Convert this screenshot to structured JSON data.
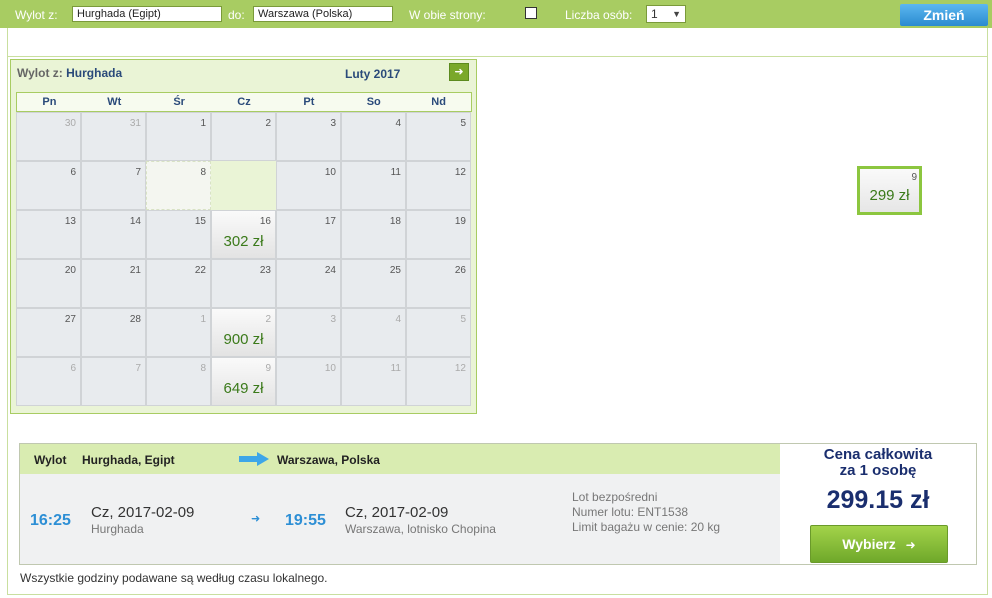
{
  "search": {
    "from_label": "Wylot z:",
    "from_value": "Hurghada (Egipt)",
    "to_label": "do:",
    "to_value": "Warszawa (Polska)",
    "roundtrip_label": "W obie strony:",
    "roundtrip_checked": false,
    "persons_label": "Liczba osób:",
    "persons_value": "1",
    "submit_label": "Zmień"
  },
  "calendar": {
    "heading_prefix": "Wylot z:",
    "heading_city": "Hurghada",
    "month": "Luty 2017",
    "next_icon": "arrow-right-icon",
    "weekdays": [
      "Pn",
      "Wt",
      "Śr",
      "Cz",
      "Pt",
      "So",
      "Nd"
    ],
    "weeks": [
      [
        {
          "d": "30",
          "dim": true
        },
        {
          "d": "31",
          "dim": true
        },
        {
          "d": "1"
        },
        {
          "d": "2"
        },
        {
          "d": "3"
        },
        {
          "d": "4"
        },
        {
          "d": "5"
        }
      ],
      [
        {
          "d": "6"
        },
        {
          "d": "7"
        },
        {
          "d": "8",
          "blank": true
        },
        {
          "d": "9",
          "price": "299 zł",
          "selected": true
        },
        {
          "d": "10"
        },
        {
          "d": "11"
        },
        {
          "d": "12"
        }
      ],
      [
        {
          "d": "13"
        },
        {
          "d": "14"
        },
        {
          "d": "15"
        },
        {
          "d": "16",
          "price": "302 zł"
        },
        {
          "d": "17"
        },
        {
          "d": "18"
        },
        {
          "d": "19"
        }
      ],
      [
        {
          "d": "20"
        },
        {
          "d": "21"
        },
        {
          "d": "22"
        },
        {
          "d": "23"
        },
        {
          "d": "24"
        },
        {
          "d": "25"
        },
        {
          "d": "26"
        }
      ],
      [
        {
          "d": "27"
        },
        {
          "d": "28"
        },
        {
          "d": "1",
          "dim": true
        },
        {
          "d": "2",
          "dim": true,
          "price": "900 zł"
        },
        {
          "d": "3",
          "dim": true
        },
        {
          "d": "4",
          "dim": true
        },
        {
          "d": "5",
          "dim": true
        }
      ],
      [
        {
          "d": "6",
          "dim": true
        },
        {
          "d": "7",
          "dim": true
        },
        {
          "d": "8",
          "dim": true
        },
        {
          "d": "9",
          "dim": true,
          "price": "649 zł"
        },
        {
          "d": "10",
          "dim": true
        },
        {
          "d": "11",
          "dim": true
        },
        {
          "d": "12",
          "dim": true
        }
      ]
    ]
  },
  "flight": {
    "label": "Wylot",
    "origin_header": "Hurghada, Egipt",
    "dest_header": "Warszawa, Polska",
    "dep_time": "16:25",
    "dep_date": "Cz, 2017-02-09",
    "dep_place": "Hurghada",
    "arr_time": "19:55",
    "arr_date": "Cz, 2017-02-09",
    "arr_place": "Warszawa, lotnisko Chopina",
    "info_direct": "Lot bezpośredni",
    "info_number": "Numer lotu: ENT1538",
    "info_baggage": "Limit bagażu w cenie: 20 kg",
    "price_title_1": "Cena całkowita",
    "price_title_2": "za 1 osobę",
    "price_value": "299.15 zł",
    "select_label": "Wybierz"
  },
  "footer_note": "Wszystkie godziny podawane są według czasu lokalnego.",
  "colors": {
    "green_bar": "#a8cc62",
    "blue_accent": "#2d8fd5",
    "price_green": "#3b7a1a",
    "navy": "#1a2e6e"
  }
}
